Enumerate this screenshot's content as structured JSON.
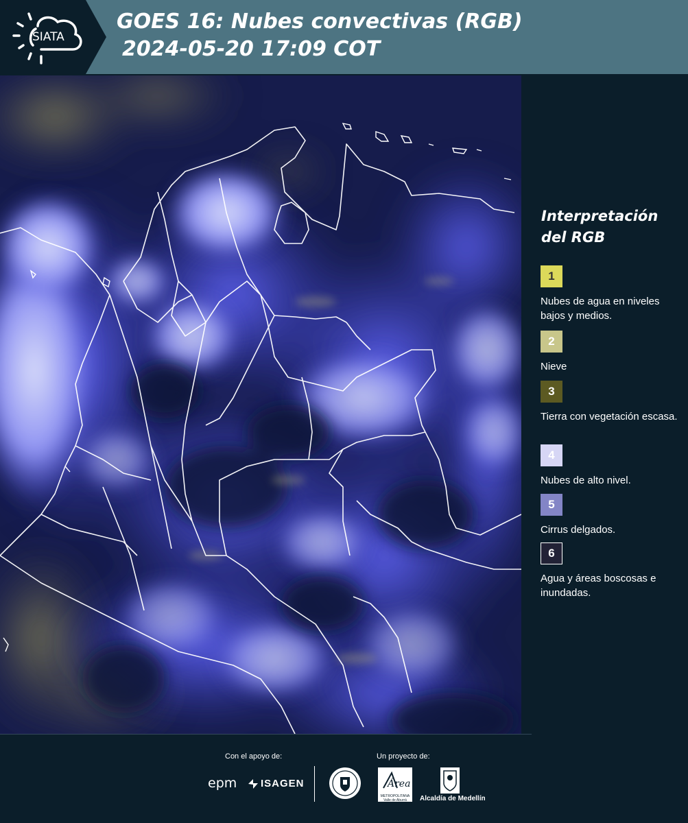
{
  "header": {
    "logo_text": "SIATA",
    "title_line1": "GOES 16: Nubes convectivas (RGB)",
    "title_line2": "2024-05-20 17:09 COT",
    "logo_icon": "sun-cloud-icon"
  },
  "map": {
    "description_icon": "satellite-rgb-image",
    "colors": {
      "background": "#141d50",
      "cloud_high": "#5a5ef0",
      "cloud_bright": "#c8ccf5",
      "border_lines": "#ffffff"
    }
  },
  "legend": {
    "title": "Interpretación del RGB",
    "items": [
      {
        "number": "1",
        "label": "Nubes de agua en niveles bajos y medios.",
        "color": "#dcd95a",
        "text_color": "#333333"
      },
      {
        "number": "2",
        "label": "Nieve",
        "color": "#c8c68a",
        "text_color": "#ffffff"
      },
      {
        "number": "3",
        "label": "Tierra con vegetación escasa.",
        "color": "#5c5a22",
        "text_color": "#ffffff"
      },
      {
        "number": "4",
        "label": "Nubes de alto nivel.",
        "color": "#d6d6f5",
        "text_color": "#ffffff"
      },
      {
        "number": "5",
        "label": "Cirrus delgados.",
        "color": "#8385c6",
        "text_color": "#ffffff"
      },
      {
        "number": "6",
        "label": "Agua y áreas boscosas e inundadas.",
        "color": "#222236",
        "text_color": "#ffffff"
      }
    ]
  },
  "footer": {
    "support_label": "Con el apoyo de:",
    "project_label": "Un proyecto de:",
    "epm": "epm",
    "isagen": "ISAGEN",
    "area_logo_text": "Área",
    "area_small": "METROPOLITANA Valle de Aburrá",
    "alcaldia": "Alcaldía de Medellín"
  }
}
